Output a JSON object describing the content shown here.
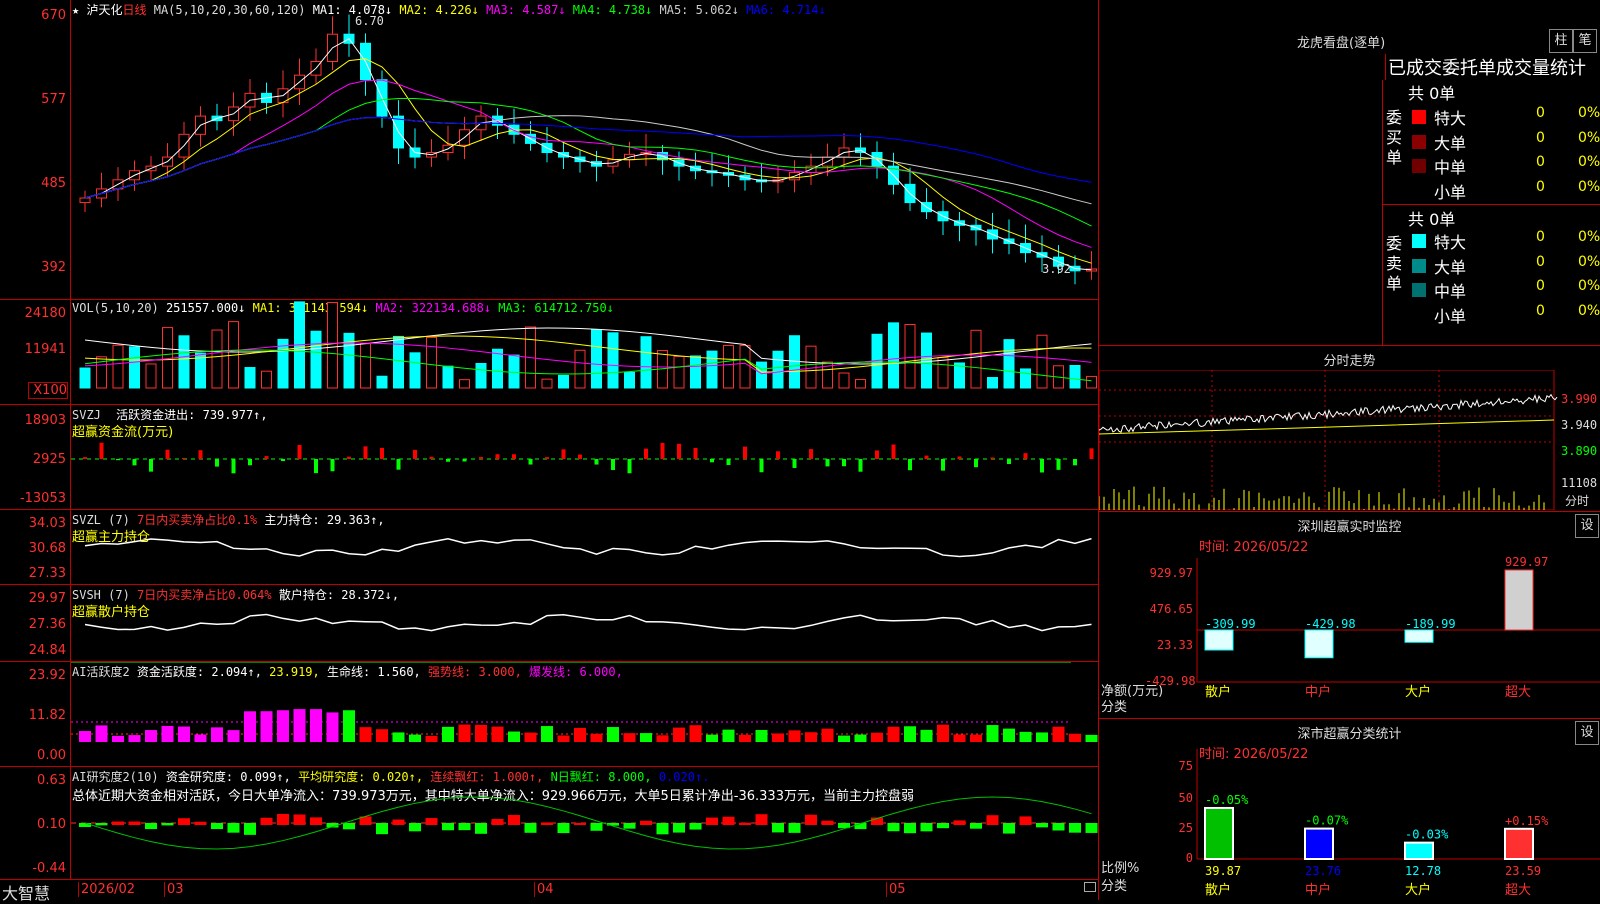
{
  "main_chart": {
    "title": "泸天化",
    "period": "日线",
    "ma_params": "MA(5,10,20,30,60,120)",
    "ma_values": [
      {
        "label": "MA1: 4.078↓",
        "color": "#ffffff"
      },
      {
        "label": "MA2: 4.226↓",
        "color": "#ffff00"
      },
      {
        "label": "MA3: 4.587↓",
        "color": "#ff00ff"
      },
      {
        "label": "MA4: 4.738↓",
        "color": "#00ff00"
      },
      {
        "label": "MA5: 5.062↓",
        "color": "#cccccc"
      },
      {
        "label": "MA6: 4.714↓",
        "color": "#0000ff"
      }
    ],
    "y_ticks": [
      "670",
      "577",
      "485",
      "392"
    ],
    "high_label": "6.70",
    "low_label": "3.92",
    "star": "★"
  },
  "vol_panel": {
    "label": "VOL(5,10,20)",
    "values": [
      {
        "label": "251557.000↓",
        "color": "#ffffff"
      },
      {
        "label": "MA1: 301143.594↓",
        "color": "#ffff00"
      },
      {
        "label": "MA2: 322134.688↓",
        "color": "#ff00ff"
      },
      {
        "label": "MA3: 614712.750↓",
        "color": "#00ff00"
      }
    ],
    "y_ticks": [
      "24180",
      "11941",
      "X100"
    ]
  },
  "svzj_panel": {
    "label": "SVZJ",
    "text1": "活跃资金进出: 739.977↑,",
    "text2": "超赢资金流(万元)",
    "y_ticks": [
      "18903",
      "2925",
      "-13053"
    ]
  },
  "svzl_panel": {
    "label": "SVZL (7)",
    "text1": "7日内买卖净占比0.1%",
    "text2": "主力持仓: 29.363↑,",
    "text3": "超赢主力持仓",
    "y_ticks": [
      "34.03",
      "30.68",
      "27.33"
    ]
  },
  "svsh_panel": {
    "label": "SVSH (7)",
    "text1": "7日内买卖净占比0.064%",
    "text2": "散户持仓: 28.372↓,",
    "text3": "超赢散户持仓",
    "y_ticks": [
      "29.97",
      "27.36",
      "24.84"
    ]
  },
  "ai_active": {
    "label": "AI活跃度2",
    "values": [
      {
        "label": "资金活跃度: 2.094↑,",
        "color": "#ffffff"
      },
      {
        "label": "23.919,",
        "color": "#ffff00"
      },
      {
        "label": "生命线: 1.560,",
        "color": "#ffffff"
      },
      {
        "label": "强势线: 3.000,",
        "color": "#ff3030"
      },
      {
        "label": "爆发线: 6.000,",
        "color": "#ff00ff"
      }
    ],
    "y_ticks": [
      "23.92",
      "11.82",
      "0.00"
    ]
  },
  "ai_research": {
    "label": "AI研究度2(10)",
    "values": [
      {
        "label": "资金研究度: 0.099↑,",
        "color": "#ffffff"
      },
      {
        "label": "平均研究度: 0.020↑,",
        "color": "#ffff00"
      },
      {
        "label": "连续飘红: 1.000↑,",
        "color": "#ff3030"
      },
      {
        "label": "N日飘红: 8.000,",
        "color": "#00ff00"
      },
      {
        "label": "0.020↑.",
        "color": "#0000ff"
      }
    ],
    "summary": "总体近期大资金相对活跃，今日大单净流入：739.973万元，其中特大单净流入：929.966万元，大单5日累计净出-36.333万元，当前主力控盘弱",
    "y_ticks": [
      "0.63",
      "0.10",
      "-0.44"
    ]
  },
  "bottom_axis": {
    "logo": "大智慧",
    "labels": [
      "2026/02",
      "03",
      "04",
      "05"
    ]
  },
  "lhkp": {
    "title": "龙虎看盘(逐单)",
    "btn_zhu": "柱",
    "btn_bi": "笔",
    "subtitle": "已成交委托单成交量统计",
    "buy_side_label": "委买单",
    "sell_side_label": "委卖单",
    "buy_total": "共 0单",
    "sell_total": "共 0单",
    "buy_rows": [
      {
        "name": "特大",
        "count": "0",
        "pct": "0%",
        "color": "#ff0000"
      },
      {
        "name": "大单",
        "count": "0",
        "pct": "0%",
        "color": "#8b0000"
      },
      {
        "name": "中单",
        "count": "0",
        "pct": "0%",
        "color": "#700000"
      },
      {
        "name": "小单",
        "count": "0",
        "pct": "0%",
        "color": ""
      }
    ],
    "sell_rows": [
      {
        "name": "特大",
        "count": "0",
        "pct": "0%",
        "color": "#00ffff"
      },
      {
        "name": "大单",
        "count": "0",
        "pct": "0%",
        "color": "#008b8b"
      },
      {
        "name": "中单",
        "count": "0",
        "pct": "0%",
        "color": "#007070"
      },
      {
        "name": "小单",
        "count": "0",
        "pct": "0%",
        "color": ""
      }
    ]
  },
  "intraday": {
    "title": "分时走势",
    "price_ticks": [
      "3.990",
      "3.940",
      "3.890"
    ],
    "vol_tick": "11108",
    "vol_label": "分时"
  },
  "sz_monitor": {
    "title": "深圳超赢实时监控",
    "btn": "设",
    "date": "时间: 2026/05/22",
    "y_ticks": [
      "929.97",
      "476.65",
      "23.33",
      "-429.98"
    ],
    "axis_label1": "净额(万元)",
    "axis_label2": "分类",
    "bars": [
      {
        "cat": "散户",
        "value": -309.99,
        "label": "-309.99",
        "cat_color": "#ffff00"
      },
      {
        "cat": "中户",
        "value": -429.98,
        "label": "-429.98",
        "cat_color": "#ff3030"
      },
      {
        "cat": "大户",
        "value": -189.99,
        "label": "-189.99",
        "cat_color": "#ffff00"
      },
      {
        "cat": "超大",
        "value": 929.97,
        "label": "929.97",
        "cat_color": "#ff3030"
      }
    ]
  },
  "sz_classify": {
    "title": "深市超赢分类统计",
    "btn": "设",
    "date": "时间: 2026/05/22",
    "y_ticks": [
      "75",
      "50",
      "25",
      "0"
    ],
    "axis_label1": "比例%",
    "axis_label2": "分类",
    "bars": [
      {
        "cat": "散户",
        "ratio": 39.87,
        "ratio_label": "39.87",
        "change": "-0.05%",
        "change_color": "#00ff00",
        "fill": "#00c000",
        "cat_color": "#ffff00",
        "ratio_color": "#ffff00"
      },
      {
        "cat": "中户",
        "ratio": 23.76,
        "ratio_label": "23.76",
        "change": "-0.07%",
        "change_color": "#00ff00",
        "fill": "#0000ff",
        "cat_color": "#ff3030",
        "ratio_color": "#0000ff"
      },
      {
        "cat": "大户",
        "ratio": 12.78,
        "ratio_label": "12.78",
        "change": "-0.03%",
        "change_color": "#00ffff",
        "fill": "#00ffff",
        "cat_color": "#ffff00",
        "ratio_color": "#00ffff"
      },
      {
        "cat": "超大",
        "ratio": 23.59,
        "ratio_label": "23.59",
        "change": "+0.15%",
        "change_color": "#ff3030",
        "fill": "#ff3030",
        "cat_color": "#ff3030",
        "ratio_color": "#ff3030"
      }
    ]
  }
}
